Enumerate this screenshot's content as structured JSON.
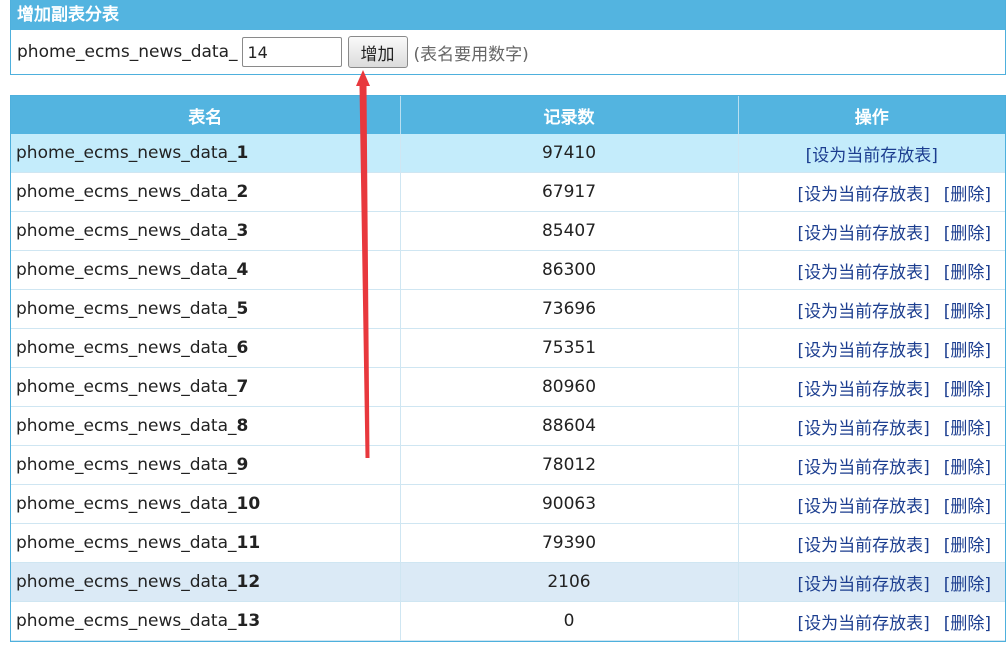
{
  "add_section": {
    "title": "增加副表分表",
    "prefix": "phome_ecms_news_data_",
    "input_value": "14",
    "button_label": "增加",
    "hint": "(表名要用数字)"
  },
  "table": {
    "headers": [
      "表名",
      "记录数",
      "操作"
    ],
    "prefix": "phome_ecms_news_data_",
    "set_current_label": "[设为当前存放表]",
    "delete_label": "[删除]",
    "rows": [
      {
        "num": "1",
        "count": "97410",
        "current": true,
        "deletable": false
      },
      {
        "num": "2",
        "count": "67917",
        "current": false,
        "deletable": true
      },
      {
        "num": "3",
        "count": "85407",
        "current": false,
        "deletable": true
      },
      {
        "num": "4",
        "count": "86300",
        "current": false,
        "deletable": true
      },
      {
        "num": "5",
        "count": "73696",
        "current": false,
        "deletable": true
      },
      {
        "num": "6",
        "count": "75351",
        "current": false,
        "deletable": true
      },
      {
        "num": "7",
        "count": "80960",
        "current": false,
        "deletable": true
      },
      {
        "num": "8",
        "count": "88604",
        "current": false,
        "deletable": true
      },
      {
        "num": "9",
        "count": "78012",
        "current": false,
        "deletable": true
      },
      {
        "num": "10",
        "count": "90063",
        "current": false,
        "deletable": true
      },
      {
        "num": "11",
        "count": "79390",
        "current": false,
        "deletable": true
      },
      {
        "num": "12",
        "count": "2106",
        "current": false,
        "deletable": true,
        "highlighted": true
      },
      {
        "num": "13",
        "count": "0",
        "current": false,
        "deletable": true
      }
    ]
  },
  "colors": {
    "header_bg": "#53b4e0",
    "current_row_bg": "#c4ecfb",
    "highlight_row_bg": "#dbeaf6",
    "link": "#1b3d8f",
    "annotation_arrow": "#e8383d"
  },
  "annotation": {
    "arrow_icon": "red-arrow-pointing-to-add-button"
  }
}
